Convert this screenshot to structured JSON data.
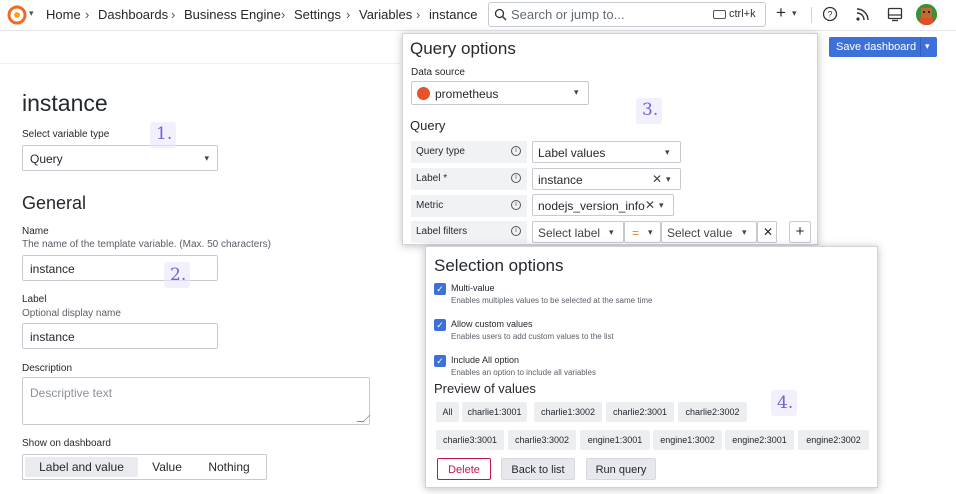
{
  "breadcrumb": [
    "Home",
    "Dashboards",
    "Business Engine",
    "Settings",
    "Variables",
    "instance"
  ],
  "search": {
    "placeholder": "Search or jump to...",
    "shortcut": "ctrl+k"
  },
  "toolbar": {
    "add_label": "+",
    "save_label": "Save dashboard"
  },
  "icons": {
    "logo": "grafana-logo-icon",
    "help": "help-icon",
    "news": "rss-icon",
    "dock": "dock-icon",
    "avatar": "user-avatar"
  },
  "form": {
    "title": "instance",
    "type_label": "Select variable type",
    "type_value": "Query",
    "general_heading": "General",
    "name_label": "Name",
    "name_desc": "The name of the template variable. (Max. 50 characters)",
    "name_value": "instance",
    "label_label": "Label",
    "label_desc": "Optional display name",
    "label_value": "instance",
    "description_label": "Description",
    "description_placeholder": "Descriptive text",
    "show_label": "Show on dashboard",
    "show_options": [
      "Label and value",
      "Value",
      "Nothing"
    ],
    "show_selected": "Label and value"
  },
  "annotations": [
    "1.",
    "2.",
    "3.",
    "4."
  ],
  "query_options": {
    "title": "Query options",
    "datasource_label": "Data source",
    "datasource_value": "prometheus",
    "query_heading": "Query",
    "query_type_label": "Query type",
    "query_type_value": "Label values",
    "label_label": "Label *",
    "label_value": "instance",
    "metric_label": "Metric",
    "metric_value": "nodejs_version_info",
    "filters_label": "Label filters",
    "filter_label_placeholder": "Select label",
    "filter_operator": "=",
    "filter_value_placeholder": "Select value"
  },
  "selection_options": {
    "title": "Selection options",
    "options": [
      {
        "title": "Multi-value",
        "desc": "Enables multiples values to be selected at the same time",
        "checked": true
      },
      {
        "title": "Allow custom values",
        "desc": "Enables users to add custom values to the list",
        "checked": true
      },
      {
        "title": "Include All option",
        "desc": "Enables an option to include all variables",
        "checked": true
      }
    ],
    "preview_heading": "Preview of values",
    "preview_row1": [
      "All",
      "charlie1:3001",
      "charlie1:3002",
      "charlie2:3001",
      "charlie2:3002"
    ],
    "preview_row2": [
      "charlie3:3001",
      "charlie3:3002",
      "engine1:3001",
      "engine1:3002",
      "engine2:3001",
      "engine2:3002"
    ],
    "delete_label": "Delete",
    "back_label": "Back to list",
    "run_label": "Run query"
  },
  "colors": {
    "primary": "#3d71d9",
    "danger": "#c4164e",
    "annotation": "#7b5fd1",
    "prometheus": "#e6522c"
  }
}
